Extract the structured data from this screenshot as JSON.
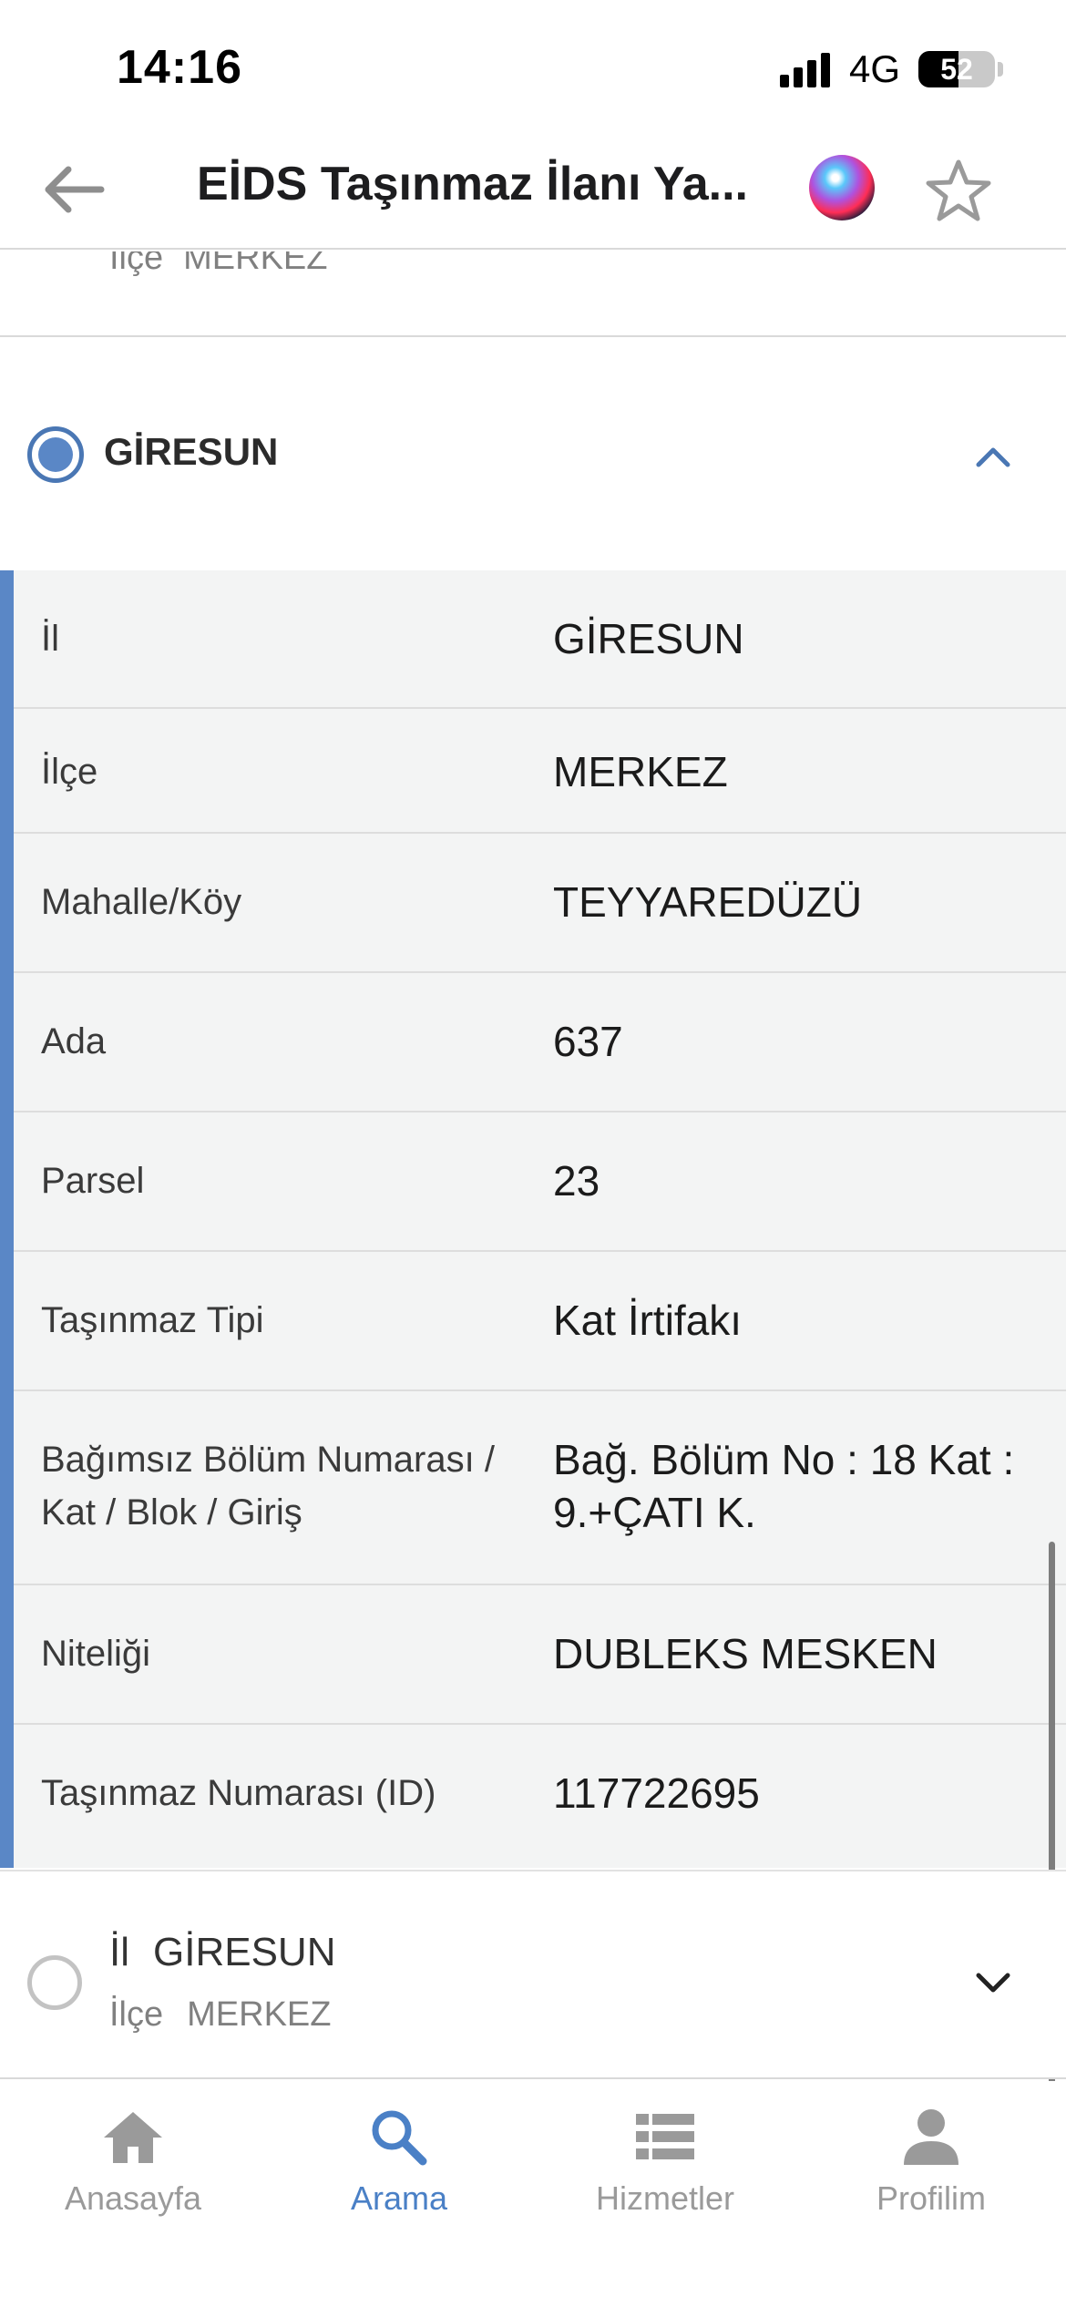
{
  "status_bar": {
    "time": "14:16",
    "network": "4G",
    "battery": "52",
    "battery_level": 0.52
  },
  "nav": {
    "title": "EİDS Taşınmaz İlanı Ya...",
    "back_icon": "arrow-left-icon",
    "assistant_icon": "siri-icon",
    "favorite_icon": "star-icon"
  },
  "previous_item": {
    "label": "İlçe",
    "value": "MERKEZ"
  },
  "expanded_card": {
    "title": "GİRESUN",
    "selected": true,
    "toggle_icon": "chevron-up-icon",
    "rows": [
      {
        "label": "İl",
        "value": "GİRESUN"
      },
      {
        "label": "İlçe",
        "value": "MERKEZ"
      },
      {
        "label": "Mahalle/Köy",
        "value": "TEYYAREDÜZÜ"
      },
      {
        "label": "Ada",
        "value": "637"
      },
      {
        "label": "Parsel",
        "value": "23"
      },
      {
        "label": "Taşınmaz Tipi",
        "value": "Kat İrtifakı"
      },
      {
        "label": "Bağımsız Bölüm Numarası / Kat / Blok / Giriş",
        "value": "Bağ. Bölüm No : 18 Kat : 9.+ÇATI K."
      },
      {
        "label": "Niteliği",
        "value": "DUBLEKS MESKEN"
      },
      {
        "label": "Taşınmaz Numarası (ID)",
        "value": "117722695"
      }
    ]
  },
  "collapsed_card": {
    "selected": false,
    "il_label": "İl",
    "il_value": "GİRESUN",
    "ilce_label": "İlçe",
    "ilce_value": "MERKEZ",
    "toggle_icon": "chevron-down-icon"
  },
  "tab_bar": {
    "active": "Arama",
    "tabs": [
      {
        "label": "Anasayfa",
        "icon": "home-icon"
      },
      {
        "label": "Arama",
        "icon": "search-icon"
      },
      {
        "label": "Hizmetler",
        "icon": "list-icon"
      },
      {
        "label": "Profilim",
        "icon": "person-icon"
      }
    ]
  },
  "colors": {
    "accent": "#5a87c6",
    "active_tab": "#4a80c6",
    "inactive_tab": "#9a9a9a",
    "table_bg": "#f3f4f4"
  }
}
